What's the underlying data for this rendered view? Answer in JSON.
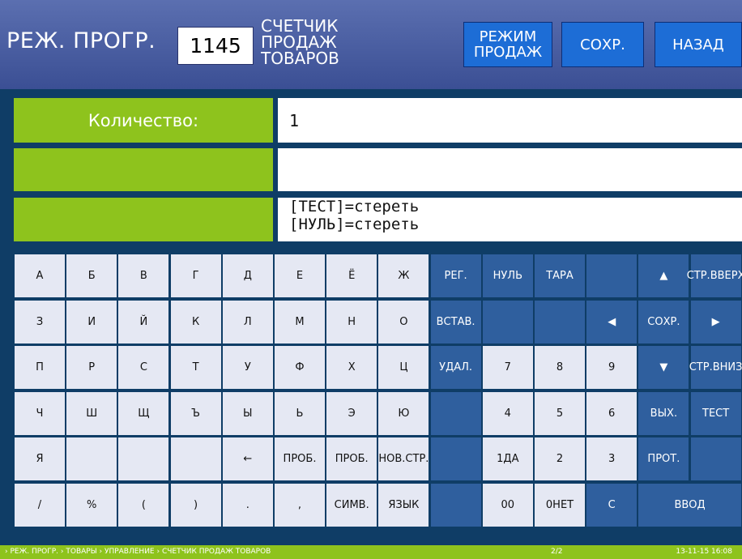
{
  "header": {
    "mode_title": "РЕЖ. ПРОГР.",
    "code": "1145",
    "screen_title_lines": [
      "СЧЕТЧИК",
      "ПРОДАЖ",
      "ТОВАРОВ"
    ],
    "buttons": {
      "sales_mode": [
        "РЕЖИМ",
        "ПРОДАЖ"
      ],
      "save": "СОХР.",
      "back": "НАЗАД"
    }
  },
  "form": {
    "quantity_label": "Количество:",
    "quantity_value": "1",
    "hint_lines": [
      "[ТЕСТ]=стереть",
      "[НУЛЬ]=стереть"
    ]
  },
  "keyboard": {
    "rows": [
      [
        "А",
        "Б",
        "В",
        "Г",
        "Д",
        "Е",
        "Ё",
        "Ж",
        "РЕГ.",
        "НУЛЬ",
        "ТАРА",
        "",
        "▲",
        "СТР.|ВВЕРХ"
      ],
      [
        "З",
        "И",
        "Й",
        "К",
        "Л",
        "М",
        "Н",
        "О",
        "ВСТАВ.",
        "",
        "",
        "◀",
        "СОХР.",
        "▶"
      ],
      [
        "П",
        "Р",
        "С",
        "Т",
        "У",
        "Ф",
        "Х",
        "Ц",
        "УДАЛ.",
        "7",
        "8",
        "9",
        "▼",
        "СТР.|ВНИЗ"
      ],
      [
        "Ч",
        "Ш",
        "Щ",
        "Ъ",
        "Ы",
        "Ь",
        "Э",
        "Ю",
        "",
        "4",
        "5",
        "6",
        "ВЫХ.",
        "ТЕСТ"
      ],
      [
        "Я",
        "",
        "",
        "",
        "←",
        "ПРОБ.",
        "ПРОБ.",
        "НОВ.|СТР.",
        "",
        "1|ДА",
        "2",
        "3",
        "ПРОТ.",
        ""
      ],
      [
        "/",
        "%",
        "(",
        ")",
        ".",
        ",",
        "СИМВ.",
        "ЯЗЫК",
        "",
        "00",
        "0|НЕТ",
        "С",
        "ВВОД"
      ]
    ]
  },
  "footer": {
    "breadcrumb": "› РЕЖ. ПРОГР.  › ТОВАРЫ › УПРАВЛЕНИЕ › СЧЕТЧИК ПРОДАЖ ТОВАРОВ",
    "page_indicator": "2/2",
    "datetime": "13-11-15  16:08"
  }
}
